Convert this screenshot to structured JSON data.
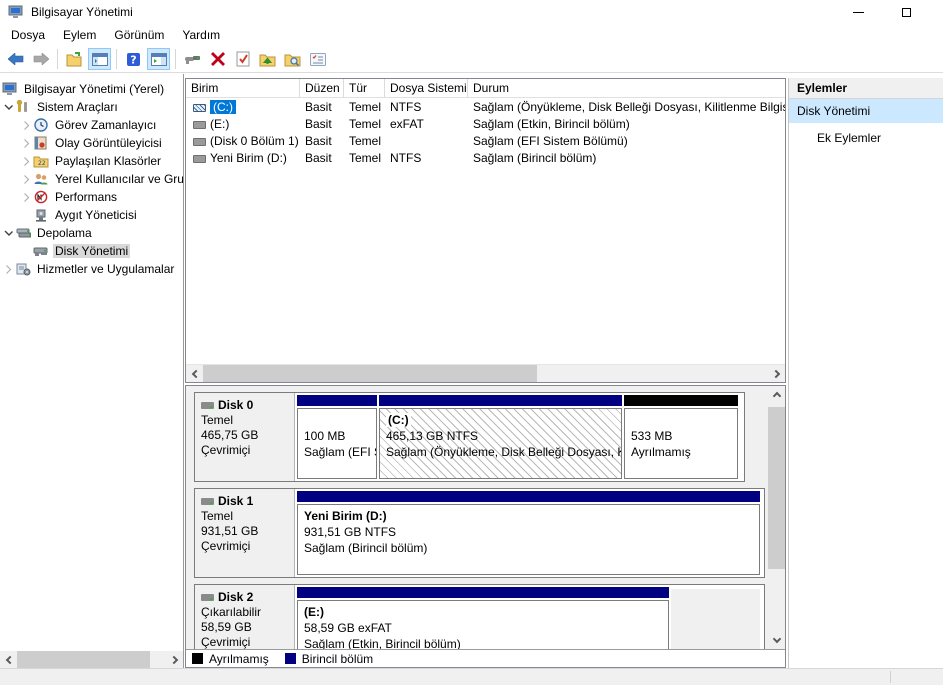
{
  "window": {
    "title": "Bilgisayar Yönetimi"
  },
  "menu": {
    "items": [
      "Dosya",
      "Eylem",
      "Görünüm",
      "Yardım"
    ]
  },
  "toolbar": {
    "icons": [
      "back",
      "forward",
      "export-list",
      "show-console-tree",
      "help",
      "show-action-pane",
      "console-snapin",
      "delete",
      "mark-partition-active",
      "open-parent-folder",
      "explore",
      "properties"
    ]
  },
  "tree": {
    "items": [
      {
        "label": "Bilgisayar Yönetimi (Yerel)",
        "icon": "computer-icon"
      },
      {
        "label": "Sistem Araçları",
        "icon": "tools-icon",
        "state": "expanded"
      },
      {
        "label": "Görev Zamanlayıcı",
        "icon": "task-scheduler-icon",
        "state": "collapsed"
      },
      {
        "label": "Olay Görüntüleyicisi",
        "icon": "event-viewer-icon",
        "state": "collapsed"
      },
      {
        "label": "Paylaşılan Klasörler",
        "icon": "shared-folders-icon",
        "state": "collapsed"
      },
      {
        "label": "Yerel Kullanıcılar ve Gru",
        "icon": "local-users-icon",
        "state": "collapsed"
      },
      {
        "label": "Performans",
        "icon": "performance-icon",
        "state": "collapsed"
      },
      {
        "label": "Aygıt Yöneticisi",
        "icon": "device-manager-icon"
      },
      {
        "label": "Depolama",
        "icon": "storage-icon",
        "state": "expanded"
      },
      {
        "label": "Disk Yönetimi",
        "icon": "disk-management-icon",
        "selected": true
      },
      {
        "label": "Hizmetler ve Uygulamalar",
        "icon": "services-icon",
        "state": "collapsed"
      }
    ]
  },
  "volumes": {
    "headers": [
      "Birim",
      "Düzen",
      "Tür",
      "Dosya Sistemi",
      "Durum"
    ],
    "rows": [
      {
        "name": "(C:)",
        "layout": "Basit",
        "type": "Temel",
        "fs": "NTFS",
        "status": "Sağlam (Önyükleme, Disk Belleği Dosyası, Kilitlenme Bilgis",
        "selected": true
      },
      {
        "name": "(E:)",
        "layout": "Basit",
        "type": "Temel",
        "fs": "exFAT",
        "status": "Sağlam (Etkin, Birincil bölüm)"
      },
      {
        "name": "(Disk 0 Bölüm 1)",
        "layout": "Basit",
        "type": "Temel",
        "fs": "",
        "status": "Sağlam (EFI Sistem Bölümü)"
      },
      {
        "name": "Yeni Birim (D:)",
        "layout": "Basit",
        "type": "Temel",
        "fs": "NTFS",
        "status": "Sağlam (Birincil bölüm)"
      }
    ]
  },
  "actions": {
    "header": "Eylemler",
    "selected": "Disk Yönetimi",
    "secondary": "Ek Eylemler"
  },
  "disks": [
    {
      "name": "Disk 0",
      "kind": "Temel",
      "size": "465,75 GB",
      "status": "Çevrimiçi",
      "partitions": [
        {
          "size": "100 MB",
          "status": "Sağlam (EFI S",
          "bar_color": "#000080"
        },
        {
          "title": "(C:)",
          "size": "465,13 GB NTFS",
          "status": "Sağlam (Önyükleme, Disk Belleği Dosyası, K",
          "bar_color": "#000080",
          "hatched": true
        },
        {
          "size": "533 MB",
          "status": "Ayrılmamış",
          "bar_color": "#000000"
        }
      ]
    },
    {
      "name": "Disk 1",
      "kind": "Temel",
      "size": "931,51 GB",
      "status": "Çevrimiçi",
      "partitions": [
        {
          "title": "Yeni Birim  (D:)",
          "size": "931,51 GB NTFS",
          "status": "Sağlam (Birincil bölüm)",
          "bar_color": "#000080"
        }
      ]
    },
    {
      "name": "Disk 2",
      "kind": "Çıkarılabilir",
      "size": "58,59 GB",
      "status": "Çevrimiçi",
      "partitions": [
        {
          "title": "(E:)",
          "size": "58,59 GB exFAT",
          "status": "Sağlam (Etkin, Birincil bölüm)",
          "bar_color": "#000080"
        }
      ]
    }
  ],
  "legend": {
    "items": [
      {
        "label": "Ayrılmamış",
        "color": "#000000"
      },
      {
        "label": "Birincil bölüm",
        "color": "#000080"
      }
    ]
  },
  "colors": {
    "selection": "#0078d7",
    "action_selected": "#cce8ff",
    "primary_partition": "#000080",
    "unallocated": "#000000"
  }
}
